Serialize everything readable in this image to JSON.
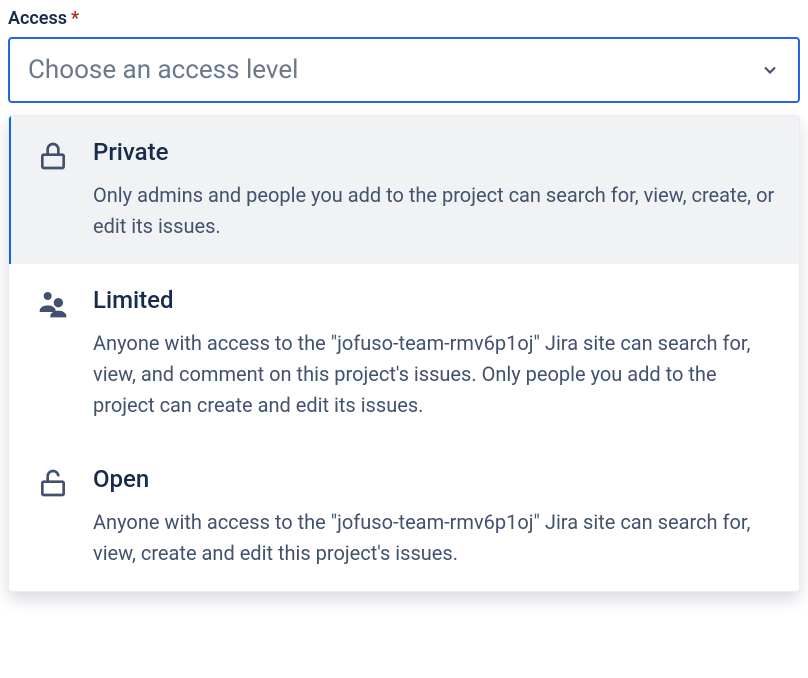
{
  "field": {
    "label": "Access",
    "required_marker": "*",
    "placeholder": "Choose an access level"
  },
  "options": [
    {
      "icon": "lock-icon",
      "title": "Private",
      "description": "Only admins and people you add to the project can search for, view, create, or edit its issues."
    },
    {
      "icon": "people-icon",
      "title": "Limited",
      "description": "Anyone with access to the \"jofuso-team-rmv6p1oj\" Jira site can search for, view, and comment on this project's issues. Only people you add to the project can create and edit its issues."
    },
    {
      "icon": "unlock-icon",
      "title": "Open",
      "description": "Anyone with access to the \"jofuso-team-rmv6p1oj\" Jira site can search for, view, create and edit this project's issues."
    }
  ]
}
